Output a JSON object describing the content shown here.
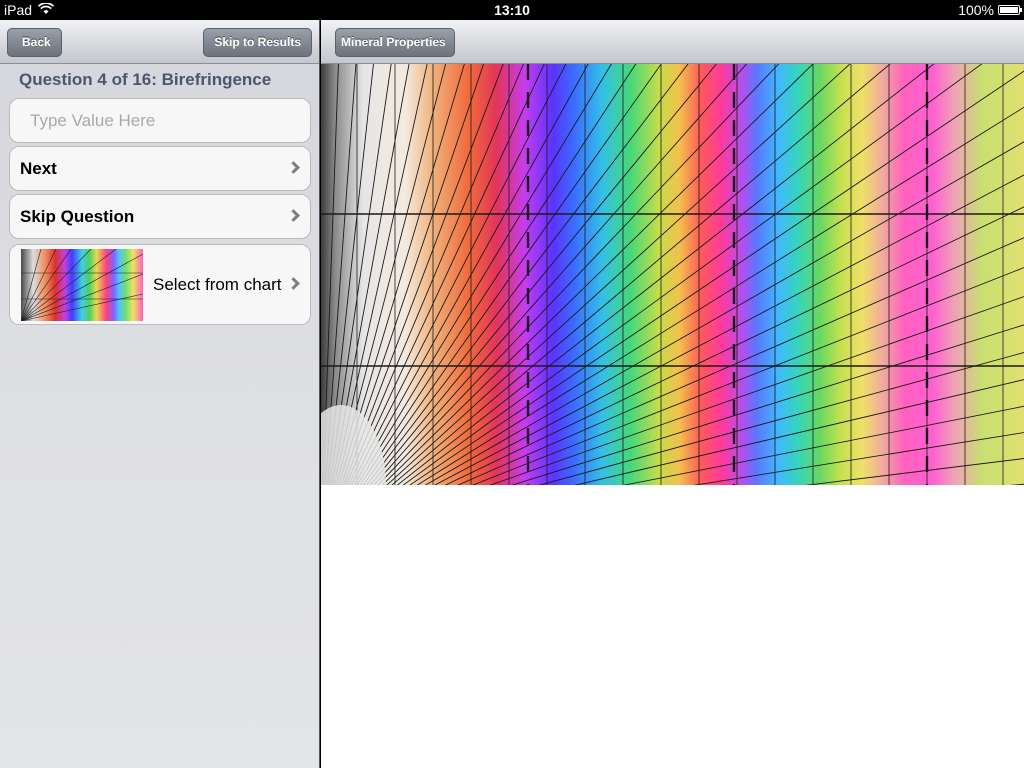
{
  "status_bar": {
    "device": "iPad",
    "wifi_icon": "wifi-icon",
    "time": "13:10",
    "battery": "100%"
  },
  "left_nav": {
    "back_label": "Back",
    "skip_results_label": "Skip to Results"
  },
  "question": {
    "title": "Question 4 of 16: Birefringence",
    "input_placeholder": "Type Value Here",
    "input_value": "",
    "next_label": "Next",
    "skip_label": "Skip Question",
    "chart_label": "Select from chart"
  },
  "right_nav": {
    "mineral_label": "Mineral Properties"
  }
}
